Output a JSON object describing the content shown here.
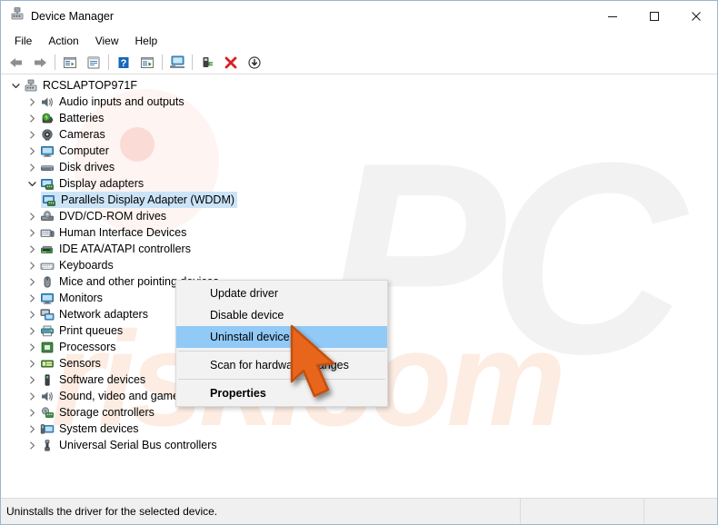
{
  "window": {
    "title": "Device Manager",
    "icon": "device-manager-icon",
    "minimize_label": "─",
    "maximize_label": "□",
    "close_label": "✕"
  },
  "menubar": {
    "items": [
      {
        "label": "File"
      },
      {
        "label": "Action"
      },
      {
        "label": "View"
      },
      {
        "label": "Help"
      }
    ]
  },
  "toolbar": {
    "buttons": [
      {
        "name": "back-button",
        "icon": "back-arrow-icon"
      },
      {
        "name": "forward-button",
        "icon": "forward-arrow-icon"
      },
      {
        "name": "separator-1",
        "icon": "separator"
      },
      {
        "name": "show-hide-console-tree-button",
        "icon": "console-tree-icon"
      },
      {
        "name": "properties-button",
        "icon": "properties-icon"
      },
      {
        "name": "separator-2",
        "icon": "separator"
      },
      {
        "name": "help-button",
        "icon": "help-question-icon"
      },
      {
        "name": "show-hide-action-pane-button",
        "icon": "action-pane-icon"
      },
      {
        "name": "separator-3",
        "icon": "separator"
      },
      {
        "name": "scan-for-hardware-changes-button",
        "icon": "scan-monitor-icon"
      },
      {
        "name": "separator-4",
        "icon": "separator"
      },
      {
        "name": "update-driver-button",
        "icon": "update-driver-icon"
      },
      {
        "name": "uninstall-device-button",
        "icon": "red-x-icon"
      },
      {
        "name": "disable-device-button",
        "icon": "down-arrow-circle-icon"
      }
    ]
  },
  "tree": {
    "root": {
      "label": "RCSLAPTOP971F",
      "icon": "computer-root-icon",
      "expanded": true
    },
    "nodes": [
      {
        "label": "Audio inputs and outputs",
        "icon": "speaker-icon",
        "expanded": false,
        "depth": 1,
        "selected": false
      },
      {
        "label": "Batteries",
        "icon": "battery-icon",
        "expanded": false,
        "depth": 1,
        "selected": false
      },
      {
        "label": "Cameras",
        "icon": "camera-icon",
        "expanded": false,
        "depth": 1,
        "selected": false
      },
      {
        "label": "Computer",
        "icon": "monitor-icon",
        "expanded": false,
        "depth": 1,
        "selected": false
      },
      {
        "label": "Disk drives",
        "icon": "disk-drive-icon",
        "expanded": false,
        "depth": 1,
        "selected": false
      },
      {
        "label": "Display adapters",
        "icon": "display-adapter-icon",
        "expanded": true,
        "depth": 1,
        "selected": false
      },
      {
        "label": "Parallels Display Adapter (WDDM)",
        "icon": "display-adapter-child-icon",
        "expanded": null,
        "depth": 2,
        "selected": true
      },
      {
        "label": "DVD/CD-ROM drives",
        "icon": "dvd-drive-icon",
        "expanded": false,
        "depth": 1,
        "selected": false
      },
      {
        "label": "Human Interface Devices",
        "icon": "hid-icon",
        "expanded": false,
        "depth": 1,
        "selected": false
      },
      {
        "label": "IDE ATA/ATAPI controllers",
        "icon": "ide-controller-icon",
        "expanded": false,
        "depth": 1,
        "selected": false
      },
      {
        "label": "Keyboards",
        "icon": "keyboard-icon",
        "expanded": false,
        "depth": 1,
        "selected": false
      },
      {
        "label": "Mice and other pointing devices",
        "icon": "mouse-icon",
        "expanded": false,
        "depth": 1,
        "selected": false
      },
      {
        "label": "Monitors",
        "icon": "monitor-icon",
        "expanded": false,
        "depth": 1,
        "selected": false
      },
      {
        "label": "Network adapters",
        "icon": "network-adapter-icon",
        "expanded": false,
        "depth": 1,
        "selected": false
      },
      {
        "label": "Print queues",
        "icon": "printer-icon",
        "expanded": false,
        "depth": 1,
        "selected": false
      },
      {
        "label": "Processors",
        "icon": "processor-icon",
        "expanded": false,
        "depth": 1,
        "selected": false
      },
      {
        "label": "Sensors",
        "icon": "sensor-icon",
        "expanded": false,
        "depth": 1,
        "selected": false
      },
      {
        "label": "Software devices",
        "icon": "software-device-icon",
        "expanded": false,
        "depth": 1,
        "selected": false
      },
      {
        "label": "Sound, video and game controllers",
        "icon": "speaker-icon",
        "expanded": false,
        "depth": 1,
        "selected": false
      },
      {
        "label": "Storage controllers",
        "icon": "storage-controller-icon",
        "expanded": false,
        "depth": 1,
        "selected": false
      },
      {
        "label": "System devices",
        "icon": "system-device-icon",
        "expanded": false,
        "depth": 1,
        "selected": false
      },
      {
        "label": "Universal Serial Bus controllers",
        "icon": "usb-icon",
        "expanded": false,
        "depth": 1,
        "selected": false
      }
    ]
  },
  "context_menu": {
    "items": [
      {
        "label": "Update driver",
        "type": "item",
        "highlight": false,
        "bold": false
      },
      {
        "label": "Disable device",
        "type": "item",
        "highlight": false,
        "bold": false
      },
      {
        "label": "Uninstall device",
        "type": "item",
        "highlight": true,
        "bold": false
      },
      {
        "label": "",
        "type": "separator",
        "highlight": false,
        "bold": false
      },
      {
        "label": "Scan for hardware changes",
        "type": "item",
        "highlight": false,
        "bold": false
      },
      {
        "label": "",
        "type": "separator",
        "highlight": false,
        "bold": false
      },
      {
        "label": "Properties",
        "type": "item",
        "highlight": false,
        "bold": true
      }
    ]
  },
  "statusbar": {
    "message": "Uninstalls the driver for the selected device."
  },
  "watermark": {
    "logo_text": "PC",
    "domain_text": "risk.com"
  },
  "colors": {
    "selection_blue": "#cce4f7",
    "menu_highlight_blue": "#91c9f7",
    "cursor_orange": "#e8661b",
    "window_border": "#9cb6cf",
    "statusbar_bg": "#f0f0f0",
    "watermark_gray": "#f2f2f2",
    "watermark_orange": "#fdece2"
  }
}
